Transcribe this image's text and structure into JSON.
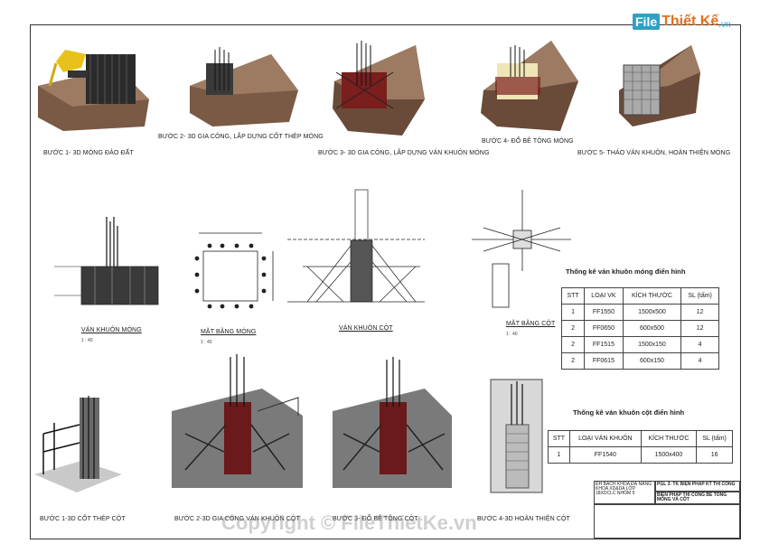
{
  "logo": {
    "badge": "File",
    "name": "Thiết Kế",
    "suffix": ".vn"
  },
  "captions": {
    "step1_excavation": "Bước 1- 3D móng đào đất",
    "step2_rebar": "Bước 2- 3D gia công, lắp dựng cốt thép móng",
    "step3_formwork": "Bước 3- 3D gia công, lắp dựng ván khuôn móng",
    "step4_pour": "Bước 4- Đổ bê tông móng",
    "step5_finish": "Bước 5- Tháo ván khuôn, hoàn thiện móng",
    "footing_formwork": "Ván khuôn móng",
    "footing_plan": "Mặt bằng móng",
    "column_formwork": "Ván khuôn cột",
    "column_plan": "Mặt bằng cột",
    "col_step1": "Bước 1-3D cốt thép cột",
    "col_step2": "Bước 2-3D gia công ván khuôn cột",
    "col_step3": "Bước 3- Đổ bê tông cột",
    "col_step4": "Bước 4-3D hoàn thiện cột"
  },
  "scales": {
    "s1": "1 : 40",
    "s2": "1 : 40",
    "s3": "1 : 40"
  },
  "footing_table": {
    "title": "Thống kê ván khuôn móng điển hình",
    "headers": [
      "STT",
      "LOẠI VK",
      "KÍCH THƯỚC",
      "SL (tấm)"
    ],
    "rows": [
      [
        "1",
        "FF1550",
        "1500x500",
        "12"
      ],
      [
        "2",
        "FF0650",
        "600x500",
        "12"
      ],
      [
        "2",
        "FF1515",
        "1500x150",
        "4"
      ],
      [
        "2",
        "FF0615",
        "600x150",
        "4"
      ]
    ]
  },
  "column_table": {
    "title": "Thống kê ván khuôn cột điển hình",
    "headers": [
      "STT",
      "LOẠI VÁN KHUÔN",
      "KÍCH THƯỚC",
      "SL (tấm)"
    ],
    "rows": [
      [
        "1",
        "FF1540",
        "1500x400",
        "16"
      ]
    ]
  },
  "title_block": {
    "school": "ĐH BÁCH KHOA ĐÀ NẴNG KHOA XD&DA LỚP 18XDCLC NHÓM 5",
    "project": "PGL 3: TK BIỆN PHÁP KT THI CÔNG",
    "drawing": "BIỆN PHÁP THI CÔNG BÊ TÔNG MÓNG VÀ CỘT"
  },
  "watermark": "Copyright © FileThietKe.vn"
}
